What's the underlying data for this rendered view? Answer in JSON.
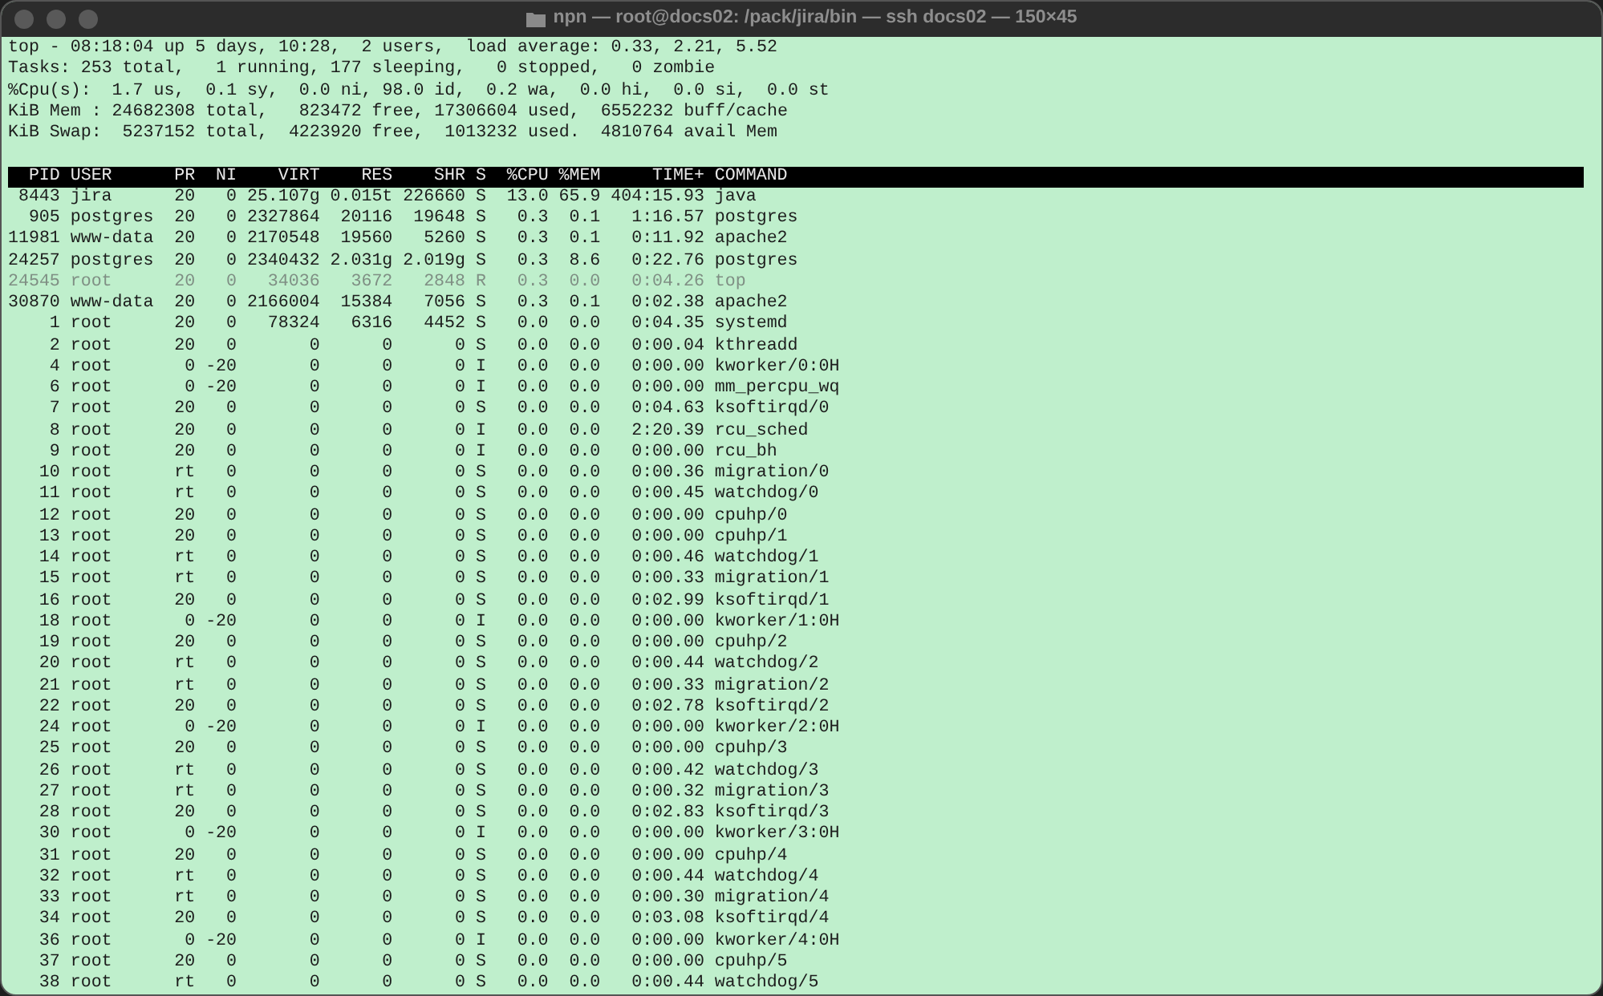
{
  "window": {
    "title": "npn — root@docs02: /pack/jira/bin — ssh docs02 — 150×45"
  },
  "summary": [
    "top - 08:18:04 up 5 days, 10:28,  2 users,  load average: 0.33, 2.21, 5.52",
    "Tasks: 253 total,   1 running, 177 sleeping,   0 stopped,   0 zombie",
    "%Cpu(s):  1.7 us,  0.1 sy,  0.0 ni, 98.0 id,  0.2 wa,  0.0 hi,  0.0 si,  0.0 st",
    "KiB Mem : 24682308 total,   823472 free, 17306604 used,  6552232 buff/cache",
    "KiB Swap:  5237152 total,  4223920 free,  1013232 used.  4810764 avail Mem"
  ],
  "table": {
    "columns": [
      "PID",
      "USER",
      "PR",
      "NI",
      "VIRT",
      "RES",
      "SHR",
      "S",
      "%CPU",
      "%MEM",
      "TIME+",
      "COMMAND"
    ],
    "rows": [
      {
        "dimmed": false,
        "cells": [
          "8443",
          "jira",
          "20",
          "0",
          "25.107g",
          "0.015t",
          "226660",
          "S",
          "13.0",
          "65.9",
          "404:15.93",
          "java"
        ]
      },
      {
        "dimmed": false,
        "cells": [
          "905",
          "postgres",
          "20",
          "0",
          "2327864",
          "20116",
          "19648",
          "S",
          "0.3",
          "0.1",
          "1:16.57",
          "postgres"
        ]
      },
      {
        "dimmed": false,
        "cells": [
          "11981",
          "www-data",
          "20",
          "0",
          "2170548",
          "19560",
          "5260",
          "S",
          "0.3",
          "0.1",
          "0:11.92",
          "apache2"
        ]
      },
      {
        "dimmed": false,
        "cells": [
          "24257",
          "postgres",
          "20",
          "0",
          "2340432",
          "2.031g",
          "2.019g",
          "S",
          "0.3",
          "8.6",
          "0:22.76",
          "postgres"
        ]
      },
      {
        "dimmed": true,
        "cells": [
          "24545",
          "root",
          "20",
          "0",
          "34036",
          "3672",
          "2848",
          "R",
          "0.3",
          "0.0",
          "0:04.26",
          "top"
        ]
      },
      {
        "dimmed": false,
        "cells": [
          "30870",
          "www-data",
          "20",
          "0",
          "2166004",
          "15384",
          "7056",
          "S",
          "0.3",
          "0.1",
          "0:02.38",
          "apache2"
        ]
      },
      {
        "dimmed": false,
        "cells": [
          "1",
          "root",
          "20",
          "0",
          "78324",
          "6316",
          "4452",
          "S",
          "0.0",
          "0.0",
          "0:04.35",
          "systemd"
        ]
      },
      {
        "dimmed": false,
        "cells": [
          "2",
          "root",
          "20",
          "0",
          "0",
          "0",
          "0",
          "S",
          "0.0",
          "0.0",
          "0:00.04",
          "kthreadd"
        ]
      },
      {
        "dimmed": false,
        "cells": [
          "4",
          "root",
          "0",
          "-20",
          "0",
          "0",
          "0",
          "I",
          "0.0",
          "0.0",
          "0:00.00",
          "kworker/0:0H"
        ]
      },
      {
        "dimmed": false,
        "cells": [
          "6",
          "root",
          "0",
          "-20",
          "0",
          "0",
          "0",
          "I",
          "0.0",
          "0.0",
          "0:00.00",
          "mm_percpu_wq"
        ]
      },
      {
        "dimmed": false,
        "cells": [
          "7",
          "root",
          "20",
          "0",
          "0",
          "0",
          "0",
          "S",
          "0.0",
          "0.0",
          "0:04.63",
          "ksoftirqd/0"
        ]
      },
      {
        "dimmed": false,
        "cells": [
          "8",
          "root",
          "20",
          "0",
          "0",
          "0",
          "0",
          "I",
          "0.0",
          "0.0",
          "2:20.39",
          "rcu_sched"
        ]
      },
      {
        "dimmed": false,
        "cells": [
          "9",
          "root",
          "20",
          "0",
          "0",
          "0",
          "0",
          "I",
          "0.0",
          "0.0",
          "0:00.00",
          "rcu_bh"
        ]
      },
      {
        "dimmed": false,
        "cells": [
          "10",
          "root",
          "rt",
          "0",
          "0",
          "0",
          "0",
          "S",
          "0.0",
          "0.0",
          "0:00.36",
          "migration/0"
        ]
      },
      {
        "dimmed": false,
        "cells": [
          "11",
          "root",
          "rt",
          "0",
          "0",
          "0",
          "0",
          "S",
          "0.0",
          "0.0",
          "0:00.45",
          "watchdog/0"
        ]
      },
      {
        "dimmed": false,
        "cells": [
          "12",
          "root",
          "20",
          "0",
          "0",
          "0",
          "0",
          "S",
          "0.0",
          "0.0",
          "0:00.00",
          "cpuhp/0"
        ]
      },
      {
        "dimmed": false,
        "cells": [
          "13",
          "root",
          "20",
          "0",
          "0",
          "0",
          "0",
          "S",
          "0.0",
          "0.0",
          "0:00.00",
          "cpuhp/1"
        ]
      },
      {
        "dimmed": false,
        "cells": [
          "14",
          "root",
          "rt",
          "0",
          "0",
          "0",
          "0",
          "S",
          "0.0",
          "0.0",
          "0:00.46",
          "watchdog/1"
        ]
      },
      {
        "dimmed": false,
        "cells": [
          "15",
          "root",
          "rt",
          "0",
          "0",
          "0",
          "0",
          "S",
          "0.0",
          "0.0",
          "0:00.33",
          "migration/1"
        ]
      },
      {
        "dimmed": false,
        "cells": [
          "16",
          "root",
          "20",
          "0",
          "0",
          "0",
          "0",
          "S",
          "0.0",
          "0.0",
          "0:02.99",
          "ksoftirqd/1"
        ]
      },
      {
        "dimmed": false,
        "cells": [
          "18",
          "root",
          "0",
          "-20",
          "0",
          "0",
          "0",
          "I",
          "0.0",
          "0.0",
          "0:00.00",
          "kworker/1:0H"
        ]
      },
      {
        "dimmed": false,
        "cells": [
          "19",
          "root",
          "20",
          "0",
          "0",
          "0",
          "0",
          "S",
          "0.0",
          "0.0",
          "0:00.00",
          "cpuhp/2"
        ]
      },
      {
        "dimmed": false,
        "cells": [
          "20",
          "root",
          "rt",
          "0",
          "0",
          "0",
          "0",
          "S",
          "0.0",
          "0.0",
          "0:00.44",
          "watchdog/2"
        ]
      },
      {
        "dimmed": false,
        "cells": [
          "21",
          "root",
          "rt",
          "0",
          "0",
          "0",
          "0",
          "S",
          "0.0",
          "0.0",
          "0:00.33",
          "migration/2"
        ]
      },
      {
        "dimmed": false,
        "cells": [
          "22",
          "root",
          "20",
          "0",
          "0",
          "0",
          "0",
          "S",
          "0.0",
          "0.0",
          "0:02.78",
          "ksoftirqd/2"
        ]
      },
      {
        "dimmed": false,
        "cells": [
          "24",
          "root",
          "0",
          "-20",
          "0",
          "0",
          "0",
          "I",
          "0.0",
          "0.0",
          "0:00.00",
          "kworker/2:0H"
        ]
      },
      {
        "dimmed": false,
        "cells": [
          "25",
          "root",
          "20",
          "0",
          "0",
          "0",
          "0",
          "S",
          "0.0",
          "0.0",
          "0:00.00",
          "cpuhp/3"
        ]
      },
      {
        "dimmed": false,
        "cells": [
          "26",
          "root",
          "rt",
          "0",
          "0",
          "0",
          "0",
          "S",
          "0.0",
          "0.0",
          "0:00.42",
          "watchdog/3"
        ]
      },
      {
        "dimmed": false,
        "cells": [
          "27",
          "root",
          "rt",
          "0",
          "0",
          "0",
          "0",
          "S",
          "0.0",
          "0.0",
          "0:00.32",
          "migration/3"
        ]
      },
      {
        "dimmed": false,
        "cells": [
          "28",
          "root",
          "20",
          "0",
          "0",
          "0",
          "0",
          "S",
          "0.0",
          "0.0",
          "0:02.83",
          "ksoftirqd/3"
        ]
      },
      {
        "dimmed": false,
        "cells": [
          "30",
          "root",
          "0",
          "-20",
          "0",
          "0",
          "0",
          "I",
          "0.0",
          "0.0",
          "0:00.00",
          "kworker/3:0H"
        ]
      },
      {
        "dimmed": false,
        "cells": [
          "31",
          "root",
          "20",
          "0",
          "0",
          "0",
          "0",
          "S",
          "0.0",
          "0.0",
          "0:00.00",
          "cpuhp/4"
        ]
      },
      {
        "dimmed": false,
        "cells": [
          "32",
          "root",
          "rt",
          "0",
          "0",
          "0",
          "0",
          "S",
          "0.0",
          "0.0",
          "0:00.44",
          "watchdog/4"
        ]
      },
      {
        "dimmed": false,
        "cells": [
          "33",
          "root",
          "rt",
          "0",
          "0",
          "0",
          "0",
          "S",
          "0.0",
          "0.0",
          "0:00.30",
          "migration/4"
        ]
      },
      {
        "dimmed": false,
        "cells": [
          "34",
          "root",
          "20",
          "0",
          "0",
          "0",
          "0",
          "S",
          "0.0",
          "0.0",
          "0:03.08",
          "ksoftirqd/4"
        ]
      },
      {
        "dimmed": false,
        "cells": [
          "36",
          "root",
          "0",
          "-20",
          "0",
          "0",
          "0",
          "I",
          "0.0",
          "0.0",
          "0:00.00",
          "kworker/4:0H"
        ]
      },
      {
        "dimmed": false,
        "cells": [
          "37",
          "root",
          "20",
          "0",
          "0",
          "0",
          "0",
          "S",
          "0.0",
          "0.0",
          "0:00.00",
          "cpuhp/5"
        ]
      },
      {
        "dimmed": false,
        "cells": [
          "38",
          "root",
          "rt",
          "0",
          "0",
          "0",
          "0",
          "S",
          "0.0",
          "0.0",
          "0:00.44",
          "watchdog/5"
        ]
      }
    ]
  }
}
